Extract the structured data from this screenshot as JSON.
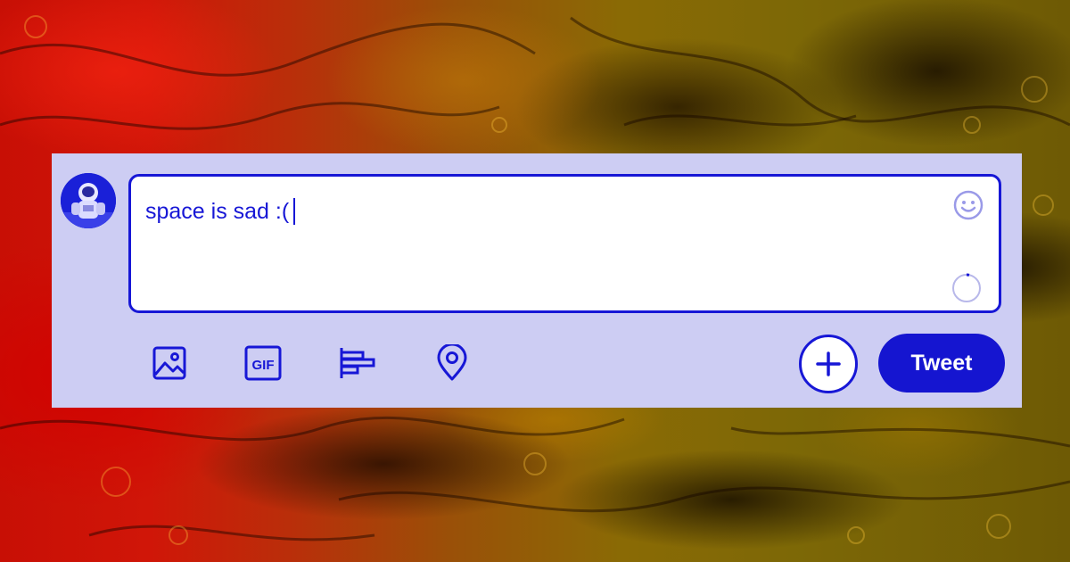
{
  "composer": {
    "text": "space is sad :(",
    "avatar_alt": "astronaut-avatar"
  },
  "toolbar": {
    "items": [
      {
        "icon": "image-icon"
      },
      {
        "icon": "gif-icon",
        "label": "GIF"
      },
      {
        "icon": "poll-icon"
      },
      {
        "icon": "location-pin-icon"
      }
    ]
  },
  "actions": {
    "add_thread_icon": "plus-icon",
    "tweet_label": "Tweet"
  },
  "colors": {
    "accent": "#1717d6",
    "panel": "#cdcdf3",
    "textbox_bg": "#ffffff"
  }
}
